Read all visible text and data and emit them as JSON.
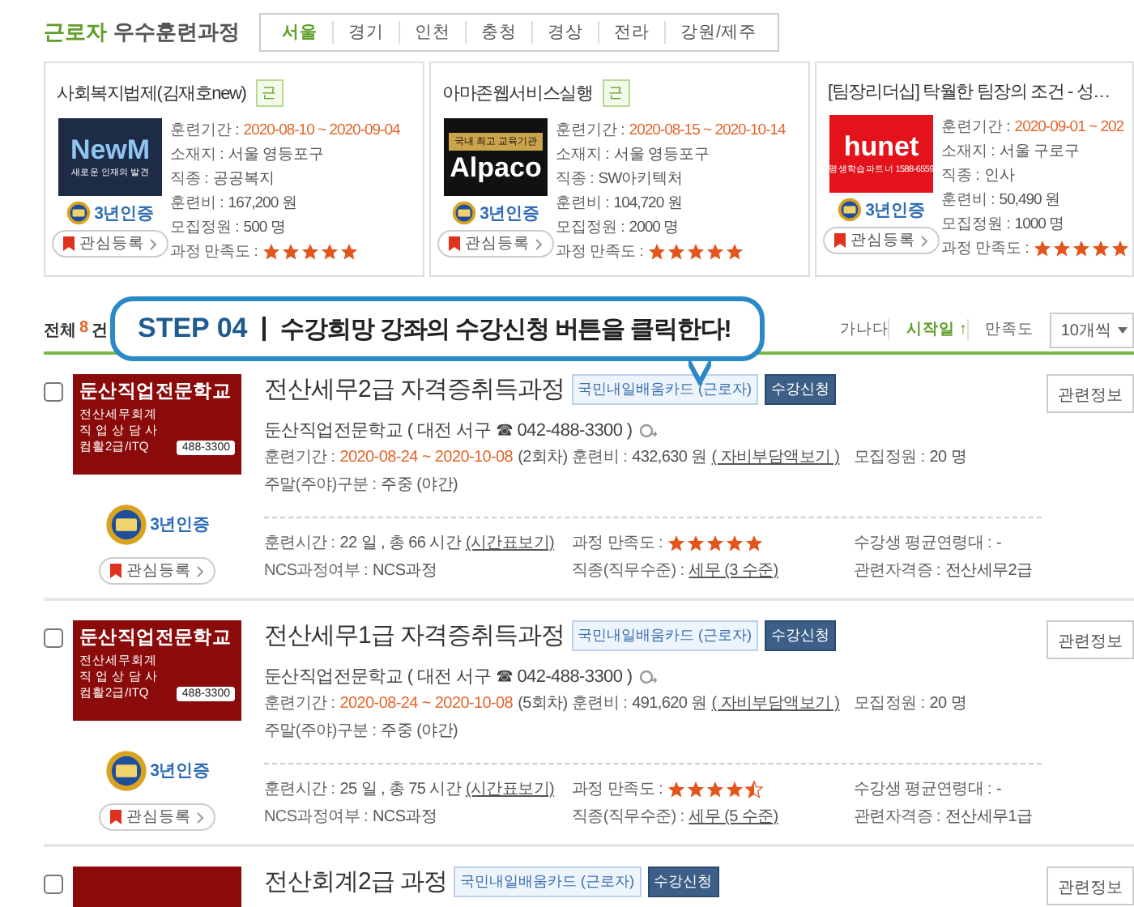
{
  "header": {
    "highlight": "근로자",
    "title": "우수훈련과정",
    "regions": [
      {
        "label": "서울",
        "selected": true
      },
      {
        "label": "경기",
        "selected": false
      },
      {
        "label": "인천",
        "selected": false
      },
      {
        "label": "충청",
        "selected": false
      },
      {
        "label": "경상",
        "selected": false
      },
      {
        "label": "전라",
        "selected": false
      },
      {
        "label": "강원/제주",
        "selected": false
      }
    ]
  },
  "cards": [
    {
      "title": "사회복지법제(김재호new)",
      "tag": "근",
      "logo": {
        "kind": "navy",
        "name": "NewM",
        "tagline": "새로운 인재의 발견"
      },
      "badge": "3년인증",
      "bookmark": "관심등록",
      "fields": [
        {
          "label": "훈련기간 :",
          "value": "2020-08-10 ~ 2020-09-04",
          "kind": "date"
        },
        {
          "label": "소재지 :",
          "value": "서울 영등포구",
          "kind": "plain"
        },
        {
          "label": "직종 :",
          "value": "공공복지",
          "kind": "plain"
        },
        {
          "label": "훈련비 :",
          "value": "167,200 원",
          "kind": "plain"
        },
        {
          "label": "모집정원 :",
          "value": "500 명",
          "kind": "plain"
        },
        {
          "label": "과정 만족도 :",
          "stars": 5
        }
      ]
    },
    {
      "title": "아마존웹서비스실행",
      "tag": "근",
      "logo": {
        "kind": "black",
        "banner": "국내 최고 교육기관",
        "name": "Alpaco"
      },
      "badge": "3년인증",
      "bookmark": "관심등록",
      "fields": [
        {
          "label": "훈련기간 :",
          "value": "2020-08-15 ~ 2020-10-14",
          "kind": "date"
        },
        {
          "label": "소재지 :",
          "value": "서울 영등포구",
          "kind": "plain"
        },
        {
          "label": "직종 :",
          "value": "SW아키텍처",
          "kind": "plain"
        },
        {
          "label": "훈련비 :",
          "value": "104,720 원",
          "kind": "plain"
        },
        {
          "label": "모집정원 :",
          "value": "2000 명",
          "kind": "plain"
        },
        {
          "label": "과정 만족도 :",
          "stars": 5
        }
      ]
    },
    {
      "title": "[팀장리더십] 탁월한 팀장의 조건 - 성…",
      "logo": {
        "kind": "red",
        "name": "hunet",
        "tagline": "평생학습파트너 1588-6559"
      },
      "badge": "3년인증",
      "bookmark": "관심등록",
      "fields": [
        {
          "label": "훈련기간 :",
          "value": "2020-09-01 ~ 202",
          "kind": "date"
        },
        {
          "label": "소재지 :",
          "value": "서울 구로구",
          "kind": "plain"
        },
        {
          "label": "직종 :",
          "value": "인사",
          "kind": "plain"
        },
        {
          "label": "훈련비 :",
          "value": "50,490 원",
          "kind": "plain"
        },
        {
          "label": "모집정원 :",
          "value": "1000 명",
          "kind": "plain"
        },
        {
          "label": "과정 만족도 :",
          "stars": 5
        }
      ]
    }
  ],
  "callout": {
    "step": "STEP 04",
    "separator": "|",
    "text": "수강희망 강좌의 수강신청 버튼을 클릭한다!"
  },
  "toolbar": {
    "total_label": "전체",
    "count": "8",
    "unit": "건",
    "sorts": [
      {
        "label": "가나다",
        "selected": false
      },
      {
        "label": "시작일 ↑",
        "selected": true
      },
      {
        "label": "만족도",
        "selected": false
      }
    ],
    "page_size": "10개씩"
  },
  "rows": [
    {
      "checked": false,
      "logo": {
        "kind": "maroon",
        "name": "둔산직업전문학교",
        "lines": [
          "전산세무회계",
          "직 업 상 담 사",
          "컴활2급/ITQ"
        ],
        "phone": "488-3300"
      },
      "badge": "3년인증",
      "bookmark": "관심등록",
      "title": "전산세무2급 자격증취득과정",
      "card_badge": "국민내일배움카드 (근로자)",
      "apply": "수강신청",
      "related": "관련정보",
      "institution": "둔산직업전문학교 ( 대전 서구 ☎ 042-488-3300 )",
      "details": [
        {
          "label": "훈련기간 :",
          "parts": [
            {
              "text": "2020-08-24 ~ 2020-10-08",
              "kind": "date"
            },
            {
              "text": "(2회차)",
              "kind": "plain"
            }
          ]
        },
        {
          "label": "훈련비 :",
          "parts": [
            {
              "text": "432,630 원",
              "kind": "plain"
            },
            {
              "text": "( 자비부담액보기 )",
              "kind": "link"
            }
          ]
        },
        {
          "label": "모집정원 :",
          "parts": [
            {
              "text": "20 명",
              "kind": "plain"
            }
          ]
        },
        {
          "label": "주말(주야)구분 :",
          "parts": [
            {
              "text": "주중 (야간)",
              "kind": "plain"
            }
          ]
        }
      ],
      "extra": [
        {
          "label": "훈련시간 :",
          "parts": [
            {
              "text": "22 일 , 총 66 시간",
              "kind": "plain"
            },
            {
              "text": "(시간표보기)",
              "kind": "link"
            }
          ]
        },
        {
          "label": "과정 만족도 :",
          "stars": 5
        },
        {
          "label": "수강생 평균연령대 :",
          "parts": [
            {
              "text": "-",
              "kind": "plain"
            }
          ]
        },
        {
          "label": "NCS과정여부 :",
          "parts": [
            {
              "text": "NCS과정",
              "kind": "plain"
            }
          ]
        },
        {
          "label": "직종(직무수준) :",
          "parts": [
            {
              "text": "세무 (3 수준)",
              "kind": "link"
            }
          ]
        },
        {
          "label": "관련자격증 :",
          "parts": [
            {
              "text": "전산세무2급",
              "kind": "plain"
            }
          ]
        }
      ]
    },
    {
      "checked": false,
      "logo": {
        "kind": "maroon",
        "name": "둔산직업전문학교",
        "lines": [
          "전산세무회계",
          "직 업 상 담 사",
          "컴활2급/ITQ"
        ],
        "phone": "488-3300"
      },
      "badge": "3년인증",
      "bookmark": "관심등록",
      "title": "전산세무1급 자격증취득과정",
      "card_badge": "국민내일배움카드 (근로자)",
      "apply": "수강신청",
      "related": "관련정보",
      "institution": "둔산직업전문학교 ( 대전 서구 ☎ 042-488-3300 )",
      "details": [
        {
          "label": "훈련기간 :",
          "parts": [
            {
              "text": "2020-08-24 ~ 2020-10-08",
              "kind": "date"
            },
            {
              "text": "(5회차)",
              "kind": "plain"
            }
          ]
        },
        {
          "label": "훈련비 :",
          "parts": [
            {
              "text": "491,620 원",
              "kind": "plain"
            },
            {
              "text": "( 자비부담액보기 )",
              "kind": "link"
            }
          ]
        },
        {
          "label": "모집정원 :",
          "parts": [
            {
              "text": "20 명",
              "kind": "plain"
            }
          ]
        },
        {
          "label": "주말(주야)구분 :",
          "parts": [
            {
              "text": "주중 (야간)",
              "kind": "plain"
            }
          ]
        }
      ],
      "extra": [
        {
          "label": "훈련시간 :",
          "parts": [
            {
              "text": "25 일 , 총 75 시간",
              "kind": "plain"
            },
            {
              "text": "(시간표보기)",
              "kind": "link"
            }
          ]
        },
        {
          "label": "과정 만족도 :",
          "stars": 4.5
        },
        {
          "label": "수강생 평균연령대 :",
          "parts": [
            {
              "text": "-",
              "kind": "plain"
            }
          ]
        },
        {
          "label": "NCS과정여부 :",
          "parts": [
            {
              "text": "NCS과정",
              "kind": "plain"
            }
          ]
        },
        {
          "label": "직종(직무수준) :",
          "parts": [
            {
              "text": "세무 (5 수준)",
              "kind": "link"
            }
          ]
        },
        {
          "label": "관련자격증 :",
          "parts": [
            {
              "text": "전산세무1급",
              "kind": "plain"
            }
          ]
        }
      ]
    },
    {
      "checked": false,
      "logo": {
        "kind": "maroon"
      },
      "title": "전산회계2급 과정",
      "card_badge": "국민내일배움카드 (근로자)",
      "apply": "수강신청",
      "related": "관련정보"
    }
  ]
}
